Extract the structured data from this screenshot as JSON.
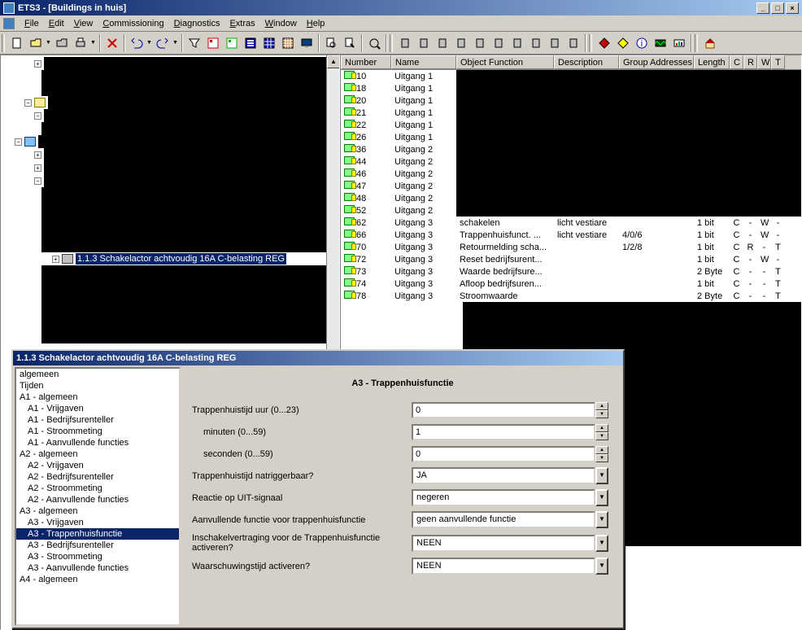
{
  "title": "ETS3 - [Buildings in huis]",
  "menu": [
    "File",
    "Edit",
    "View",
    "Commissioning",
    "Diagnostics",
    "Extras",
    "Window",
    "Help"
  ],
  "tree": {
    "selected": "1.1.3 Schakelactor achtvoudig 16A C-belasting REG"
  },
  "grid": {
    "columns": [
      "Number",
      "Name",
      "Object Function",
      "Description",
      "Group Addresses",
      "Length",
      "C",
      "R",
      "W",
      "T"
    ],
    "rows": [
      {
        "num": "10",
        "name": "Uitgang 1"
      },
      {
        "num": "18",
        "name": "Uitgang 1"
      },
      {
        "num": "20",
        "name": "Uitgang 1"
      },
      {
        "num": "21",
        "name": "Uitgang 1"
      },
      {
        "num": "22",
        "name": "Uitgang 1"
      },
      {
        "num": "26",
        "name": "Uitgang 1"
      },
      {
        "num": "36",
        "name": "Uitgang 2"
      },
      {
        "num": "44",
        "name": "Uitgang 2"
      },
      {
        "num": "46",
        "name": "Uitgang 2"
      },
      {
        "num": "47",
        "name": "Uitgang 2"
      },
      {
        "num": "48",
        "name": "Uitgang 2"
      },
      {
        "num": "52",
        "name": "Uitgang 2"
      },
      {
        "num": "62",
        "name": "Uitgang 3",
        "func": "schakelen",
        "desc": "licht vestiare",
        "grp": "",
        "len": "1 bit",
        "c": "C",
        "r": "-",
        "w": "W",
        "t": "-"
      },
      {
        "num": "66",
        "name": "Uitgang 3",
        "func": "Trappenhuisfunct. ...",
        "desc": "licht vestiare",
        "grp": "4/0/6",
        "len": "1 bit",
        "c": "C",
        "r": "-",
        "w": "W",
        "t": "-"
      },
      {
        "num": "70",
        "name": "Uitgang 3",
        "func": "Retourmelding scha...",
        "desc": "",
        "grp": "1/2/8",
        "len": "1 bit",
        "c": "C",
        "r": "R",
        "w": "-",
        "t": "T"
      },
      {
        "num": "72",
        "name": "Uitgang 3",
        "func": "Reset bedrijfsurent...",
        "desc": "",
        "grp": "",
        "len": "1 bit",
        "c": "C",
        "r": "-",
        "w": "W",
        "t": "-"
      },
      {
        "num": "73",
        "name": "Uitgang 3",
        "func": "Waarde bedrijfsure...",
        "desc": "",
        "grp": "",
        "len": "2 Byte",
        "c": "C",
        "r": "-",
        "w": "-",
        "t": "T"
      },
      {
        "num": "74",
        "name": "Uitgang 3",
        "func": "Afloop bedrijfsuren...",
        "desc": "",
        "grp": "",
        "len": "1 bit",
        "c": "C",
        "r": "-",
        "w": "-",
        "t": "T"
      },
      {
        "num": "78",
        "name": "Uitgang 3",
        "func": "Stroomwaarde",
        "desc": "",
        "grp": "",
        "len": "2 Byte",
        "c": "C",
        "r": "-",
        "w": "-",
        "t": "T"
      }
    ]
  },
  "dialog": {
    "title": "1.1.3 Schakelactor achtvoudig 16A C-belasting REG",
    "nav": [
      {
        "label": "algemeen"
      },
      {
        "label": "Tijden"
      },
      {
        "label": "A1 - algemeen"
      },
      {
        "label": "A1 - Vrijgaven",
        "indent": true
      },
      {
        "label": "A1 - Bedrijfsurenteller",
        "indent": true
      },
      {
        "label": "A1 - Stroommeting",
        "indent": true
      },
      {
        "label": "A1 - Aanvullende functies",
        "indent": true
      },
      {
        "label": "A2 - algemeen"
      },
      {
        "label": "A2 - Vrijgaven",
        "indent": true
      },
      {
        "label": "A2 - Bedrijfsurenteller",
        "indent": true
      },
      {
        "label": "A2 - Stroommeting",
        "indent": true
      },
      {
        "label": "A2 - Aanvullende functies",
        "indent": true
      },
      {
        "label": "A3 - algemeen"
      },
      {
        "label": "A3 - Vrijgaven",
        "indent": true
      },
      {
        "label": "A3 - Trappenhuisfunctie",
        "indent": true,
        "sel": true
      },
      {
        "label": "A3 - Bedrijfsurenteller",
        "indent": true
      },
      {
        "label": "A3 - Stroommeting",
        "indent": true
      },
      {
        "label": "A3 - Aanvullende functies",
        "indent": true
      },
      {
        "label": "A4 - algemeen"
      }
    ],
    "panel_title": "A3 - Trappenhuisfunctie",
    "params": [
      {
        "label": "Trappenhuistijd\nuur (0...23)",
        "type": "spin",
        "value": "0"
      },
      {
        "label": "minuten (0...59)",
        "type": "spin",
        "value": "1",
        "indent": true
      },
      {
        "label": "seconden (0...59)",
        "type": "spin",
        "value": "0",
        "indent": true
      },
      {
        "label": "Trappenhuistijd natriggerbaar?",
        "type": "combo",
        "value": "JA"
      },
      {
        "label": "Reactie op UIT-signaal",
        "type": "combo",
        "value": "negeren"
      },
      {
        "label": "Aanvullende functie voor trappenhuisfunctie",
        "type": "combo",
        "value": "geen aanvullende functie"
      },
      {
        "label": "Inschakelvertraging voor de Trappenhuisfunctie activeren?",
        "type": "combo",
        "value": "NEEN"
      },
      {
        "label": "Waarschuwingstijd activeren?",
        "type": "combo",
        "value": "NEEN"
      }
    ]
  }
}
